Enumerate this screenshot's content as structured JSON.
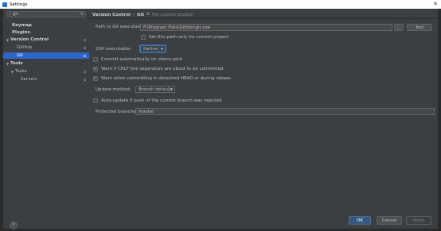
{
  "window": {
    "title": "Settings"
  },
  "sidebar": {
    "search_value": "git",
    "items": [
      {
        "label": "Keymap"
      },
      {
        "label": "Plugins"
      },
      {
        "label": "Version Control"
      },
      {
        "label": "GitHub"
      },
      {
        "label": "Git"
      },
      {
        "label": "Tools"
      },
      {
        "label": "Tasks"
      },
      {
        "label": "Servers"
      }
    ]
  },
  "header": {
    "crumb1": "Version Control",
    "separator": "›",
    "crumb2": "Git",
    "for_project": "For current project"
  },
  "form": {
    "path_label": "Path to Git executable:",
    "path_value": "F:\\Program Files\\Git\\bin\\git.exe",
    "browse_label": "...",
    "test_label": "Test",
    "set_path_label": "Set this path only for current project",
    "ssh_label": "SSH executable:",
    "ssh_value": "Native",
    "commit_cherry_label": "Commit automatically on cherry-pick",
    "warn_crlf_label": "Warn if CRLF line separators are about to be committed",
    "warn_detached_label": "Warn when committing in detached HEAD or during rebase",
    "update_method_label": "Update method:",
    "update_method_value": "Branch default",
    "auto_update_label": "Auto-update if push of the current branch was rejected",
    "protected_label": "Protected branches:",
    "protected_value": "master"
  },
  "footer": {
    "help_label": "?",
    "ok_label": "OK",
    "cancel_label": "Cancel",
    "apply_label": "Apply"
  }
}
